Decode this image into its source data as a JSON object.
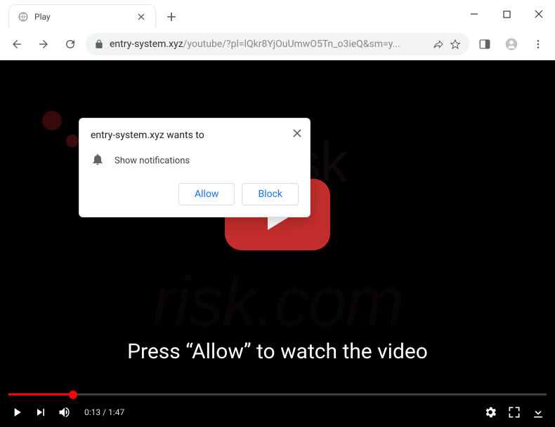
{
  "tab": {
    "title": "Play"
  },
  "url": {
    "domain": "entry-system.xyz",
    "path": "/youtube/?pl=lQkr8YjOuUmwO5Tn_o3ieQ&sm=y..."
  },
  "popup": {
    "origin": "entry-system.xyz wants to",
    "permission_label": "Show notifications",
    "allow_label": "Allow",
    "block_label": "Block"
  },
  "page": {
    "message": "Press “Allow” to watch the video"
  },
  "player": {
    "elapsed": "0:13",
    "duration": "1:47"
  },
  "watermark": {
    "line1": "pcrisk",
    "line2": "risk.com"
  }
}
